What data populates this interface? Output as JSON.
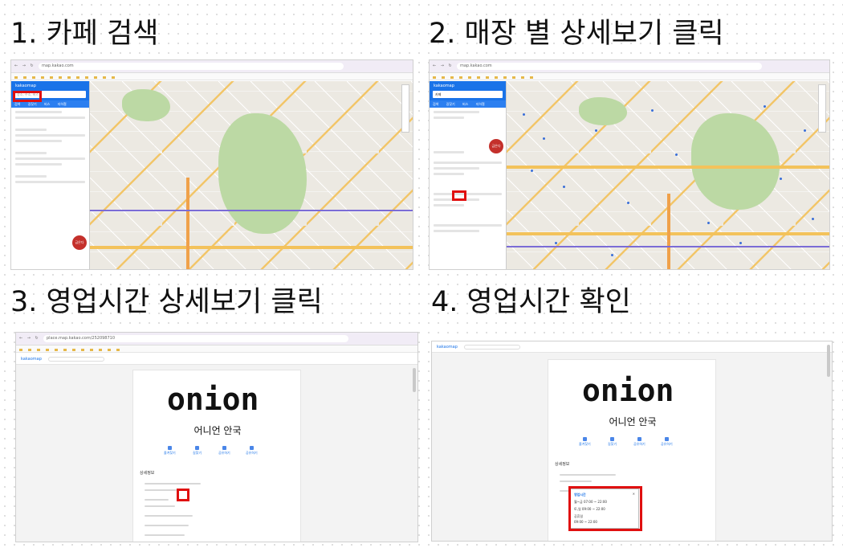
{
  "steps": [
    {
      "title": "1. 카페 검색"
    },
    {
      "title": "2. 매장 별 상세보기 클릭"
    },
    {
      "title": "3. 영업시간 상세보기 클릭"
    },
    {
      "title": "4. 영업시간 확인"
    }
  ],
  "browser": {
    "url_map": "map.kakao.com",
    "url_place": "place.map.kakao.com/252098710",
    "nav_glyphs": "← → ↻"
  },
  "map_ui": {
    "logo": "kakaomap",
    "search_placeholder": "장소, 주소, 버스",
    "search_value": "카페",
    "tabs": [
      "검색",
      "길찾기",
      "버스",
      "지하철",
      "즐겨찾기"
    ],
    "badge_label": "금은다",
    "highlight_color": "#e01010"
  },
  "place_ui": {
    "logo": "kakaomap",
    "brand_word": "onion",
    "place_name": "어니언 안국",
    "actions": [
      "즐겨찾기",
      "길찾기",
      "공유하기",
      "공유하기"
    ],
    "info_heading": "상세정보"
  },
  "hours_popup": {
    "title": "영업시간",
    "line1": "월~금 07:00 ~ 22:00",
    "line2": "토,일 09:00 ~ 22:00",
    "holiday_label": "공휴일",
    "line3": "09:00 ~ 22:00",
    "close_glyph": "✕"
  }
}
